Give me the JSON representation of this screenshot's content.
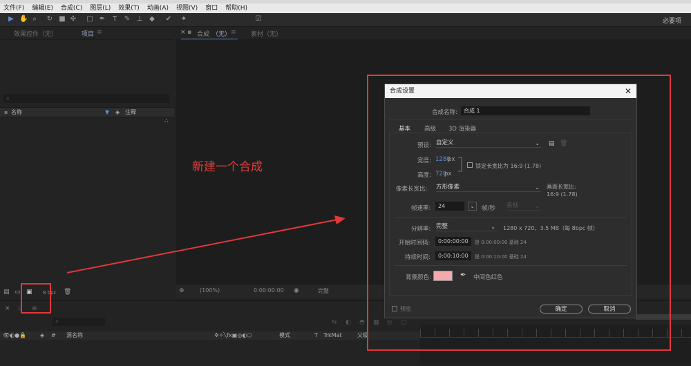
{
  "menu": [
    "文件(F)",
    "编辑(E)",
    "合成(C)",
    "图层(L)",
    "效果(T)",
    "动画(A)",
    "视图(V)",
    "窗口",
    "帮助(H)"
  ],
  "toolbar": {
    "workspace": "必要项"
  },
  "left_panel": {
    "tab_effects": "效果控件（无）",
    "tab_project": "项目",
    "col_name": "名称",
    "col_comment": "注释",
    "bpc": "8 bpc"
  },
  "viewer": {
    "tab_comp": "合成",
    "tab_comp_value": "（无）",
    "tab_footage": "素材（无）",
    "zoom": "(100%)",
    "timecode": "0:00:00:00",
    "resolution": "完整"
  },
  "timeline": {
    "col_source": "源名称",
    "col_mode": "模式",
    "col_t": "T",
    "col_trkmat": "TrkMat",
    "col_parent": "父级"
  },
  "annotation": {
    "text": "新建一个合成",
    "color": "#e2383b"
  },
  "dialog": {
    "title": "合成设置",
    "name_label": "合成名称:",
    "name_value": "合成 1",
    "tabs": [
      "基本",
      "高级",
      "3D 渲染器"
    ],
    "preset_label": "预设:",
    "preset_value": "自定义",
    "width_label": "宽度:",
    "width_value": "1280",
    "height_label": "高度:",
    "height_value": "720",
    "unit": "px",
    "lock_label": "锁定长宽比为 16:9 (1.78)",
    "par_label": "像素长宽比:",
    "par_value": "方形像素",
    "frame_ar_label": "画面长宽比:",
    "frame_ar_value": "16:9 (1.78)",
    "fps_label": "帧速率:",
    "fps_value": "24",
    "fps_unit": "帧/秒",
    "fps_drop": "丢帧",
    "res_label": "分辨率:",
    "res_value": "完整",
    "res_info": "1280 x 720，3.5 MB（每 8bpc 帧）",
    "start_label": "开始时间码:",
    "start_value": "0:00:00:00",
    "start_info": "是 0:00:00:00  基础 24",
    "dur_label": "持续时间:",
    "dur_value": "0:00:10:00",
    "dur_info": "是 0:00:10:00  基础 24",
    "bg_label": "背景颜色:",
    "bg_name": "中间色红色",
    "bg_color": "#f3a9ad",
    "preview_label": "预览",
    "ok": "确定",
    "cancel": "取消"
  }
}
